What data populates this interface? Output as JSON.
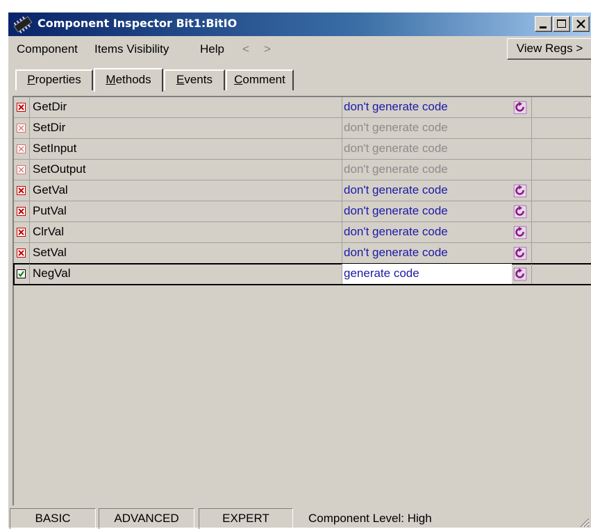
{
  "window": {
    "title": "Component Inspector Bit1:BitIO",
    "icon": "chip-icon",
    "controls": [
      "minimize-icon",
      "maximize-icon",
      "close-icon"
    ]
  },
  "menu": {
    "items": [
      "Component",
      "Items Visibility",
      "Help"
    ],
    "back_arrow": "<",
    "forward_arrow": ">",
    "view_regs": "View Regs >"
  },
  "tabs": [
    {
      "pre": "",
      "ul": "P",
      "post": "roperties"
    },
    {
      "pre": "",
      "ul": "M",
      "post": "ethods"
    },
    {
      "pre": "",
      "ul": "E",
      "post": "vents"
    },
    {
      "pre": "",
      "ul": "C",
      "post": "omment"
    }
  ],
  "active_tab": "Methods",
  "methods": [
    {
      "name": "GetDir",
      "value": "don't generate code",
      "enabled": true,
      "state": "no",
      "refresh": true
    },
    {
      "name": "SetDir",
      "value": "don't generate code",
      "enabled": false,
      "state": "no",
      "refresh": false
    },
    {
      "name": "SetInput",
      "value": "don't generate code",
      "enabled": false,
      "state": "no",
      "refresh": false
    },
    {
      "name": "SetOutput",
      "value": "don't generate code",
      "enabled": false,
      "state": "no",
      "refresh": false
    },
    {
      "name": "GetVal",
      "value": "don't generate code",
      "enabled": true,
      "state": "no",
      "refresh": true
    },
    {
      "name": "PutVal",
      "value": "don't generate code",
      "enabled": true,
      "state": "no",
      "refresh": true
    },
    {
      "name": "ClrVal",
      "value": "don't generate code",
      "enabled": true,
      "state": "no",
      "refresh": true
    },
    {
      "name": "SetVal",
      "value": "don't generate code",
      "enabled": true,
      "state": "no",
      "refresh": true
    },
    {
      "name": "NegVal",
      "value": "generate code",
      "enabled": true,
      "state": "yes",
      "refresh": true,
      "selected": true
    }
  ],
  "status": {
    "levels": [
      "BASIC",
      "ADVANCED",
      "EXPERT"
    ],
    "level_text": "Component Level: High"
  },
  "colors": {
    "title_gradient_start": "#0a246a",
    "title_gradient_end": "#a6caf0",
    "face": "#d4d0c8",
    "enabled_text": "#1b1ba6",
    "disabled_text": "#8c8c8c",
    "refresh_icon": "#8b1a8b"
  }
}
